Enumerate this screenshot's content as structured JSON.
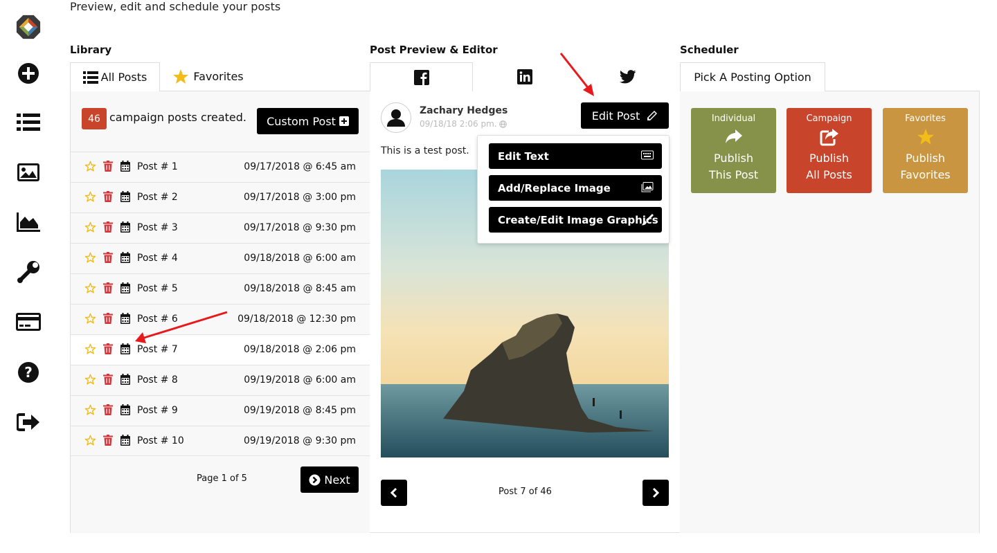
{
  "header": {
    "subtitle": "Preview, edit and schedule your posts"
  },
  "sidebar": {
    "icons": [
      "logo-icon",
      "plus-circle-icon",
      "list-icon",
      "image-icon",
      "chart-area-icon",
      "wrench-icon",
      "credit-card-icon",
      "question-circle-icon",
      "sign-out-icon"
    ]
  },
  "library": {
    "title": "Library",
    "tabs": [
      {
        "label": "All Posts"
      },
      {
        "label": "Favorites"
      }
    ],
    "count": "46",
    "count_text": "campaign posts created.",
    "custom_post_label": "Custom Post",
    "posts": [
      {
        "name": "Post # 1",
        "date": "09/17/2018 @ 6:45 am"
      },
      {
        "name": "Post # 2",
        "date": "09/17/2018 @ 3:00 pm"
      },
      {
        "name": "Post # 3",
        "date": "09/17/2018 @ 9:30 pm"
      },
      {
        "name": "Post # 4",
        "date": "09/18/2018 @ 6:00 am"
      },
      {
        "name": "Post # 5",
        "date": "09/18/2018 @ 8:45 am"
      },
      {
        "name": "Post # 6",
        "date": "09/18/2018 @ 12:30 pm"
      },
      {
        "name": "Post # 7",
        "date": "09/18/2018 @ 2:06 pm"
      },
      {
        "name": "Post # 8",
        "date": "09/19/2018 @ 6:00 am"
      },
      {
        "name": "Post # 9",
        "date": "09/19/2018 @ 8:45 pm"
      },
      {
        "name": "Post # 10",
        "date": "09/19/2018 @ 9:30 pm"
      }
    ],
    "page_info": "Page 1 of 5",
    "next_label": "Next"
  },
  "preview": {
    "title": "Post Preview & Editor",
    "tabs": [
      {
        "icon": "facebook-icon"
      },
      {
        "icon": "linkedin-icon"
      },
      {
        "icon": "twitter-icon"
      }
    ],
    "author": "Zachary Hedges",
    "timestamp": "09/18/18 2:06 pm.",
    "edit_post_label": "Edit Post",
    "post_text": "This is a test post.",
    "menu": [
      {
        "label": "Edit Text",
        "icon": "keyboard-icon"
      },
      {
        "label": "Add/Replace Image",
        "icon": "images-icon"
      },
      {
        "label": "Create/Edit Image Graphics",
        "icon": "paint-brush-icon"
      }
    ],
    "post_position": "Post 7 of 46"
  },
  "scheduler": {
    "title": "Scheduler",
    "tab_label": "Pick A Posting Option",
    "options": [
      {
        "top": "Individual",
        "line1": "Publish",
        "line2": "This Post",
        "color": "#86924a"
      },
      {
        "top": "Campaign",
        "line1": "Publish",
        "line2": "All Posts",
        "color": "#c8442a"
      },
      {
        "top": "Favorites",
        "line1": "Publish",
        "line2": "Favorites",
        "color": "#c99540"
      }
    ]
  },
  "colors": {
    "star": "#f2bc1b",
    "trash": "#d0353b",
    "badge": "#c8442a",
    "annotation_arrow": "#e8191c"
  }
}
